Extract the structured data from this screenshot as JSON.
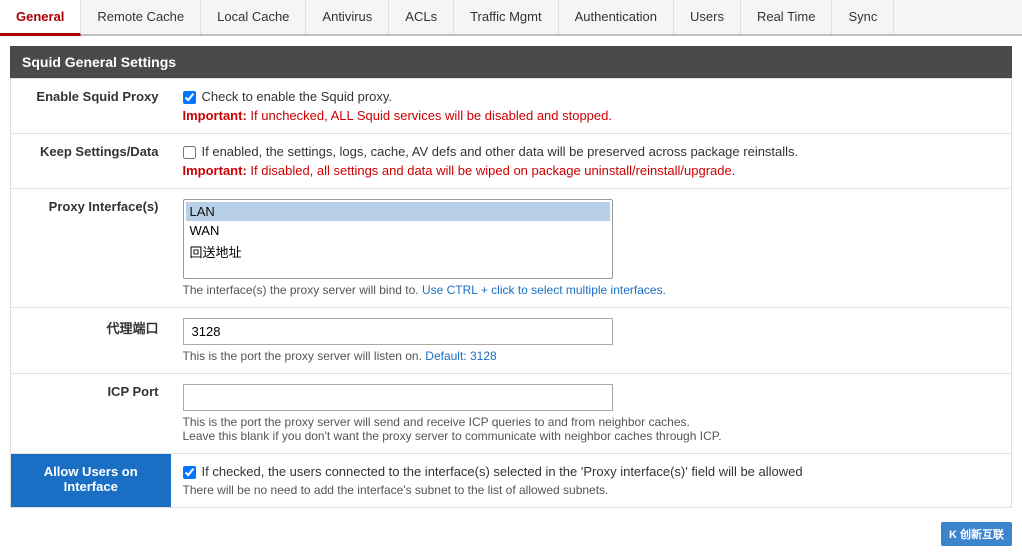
{
  "tabs": [
    {
      "id": "general",
      "label": "General",
      "active": true
    },
    {
      "id": "remote-cache",
      "label": "Remote Cache",
      "active": false
    },
    {
      "id": "local-cache",
      "label": "Local Cache",
      "active": false
    },
    {
      "id": "antivirus",
      "label": "Antivirus",
      "active": false
    },
    {
      "id": "acls",
      "label": "ACLs",
      "active": false
    },
    {
      "id": "traffic-mgmt",
      "label": "Traffic Mgmt",
      "active": false
    },
    {
      "id": "authentication",
      "label": "Authentication",
      "active": false
    },
    {
      "id": "users",
      "label": "Users",
      "active": false
    },
    {
      "id": "real-time",
      "label": "Real Time",
      "active": false
    },
    {
      "id": "sync",
      "label": "Sync",
      "active": false
    }
  ],
  "section_title": "Squid General Settings",
  "fields": {
    "enable_squid_proxy": {
      "label": "Enable Squid Proxy",
      "checkbox_text": "Check to enable the Squid proxy.",
      "important_label": "Important:",
      "important_text": " If unchecked, ALL Squid services will be disabled and stopped.",
      "checked": true
    },
    "keep_settings": {
      "label": "Keep Settings/Data",
      "checkbox_text": "If enabled, the settings, logs, cache, AV defs and other data will be preserved across package reinstalls.",
      "important_label": "Important:",
      "important_text": " If disabled, all settings and data will be wiped on package uninstall/reinstall/upgrade.",
      "checked": false
    },
    "proxy_interfaces": {
      "label": "Proxy Interface(s)",
      "options": [
        "LAN",
        "WAN",
        "回送地址"
      ],
      "selected": "LAN",
      "hint": "The interface(s) the proxy server will bind to.",
      "hint_link": "Use CTRL + click to select multiple interfaces.",
      "hint_after": ""
    },
    "proxy_port": {
      "label": "代理端口",
      "value": "3128",
      "placeholder": "",
      "hint": "This is the port the proxy server will listen on.",
      "default_label": "Default: 3128"
    },
    "icp_port": {
      "label": "ICP Port",
      "value": "",
      "placeholder": "",
      "hint1": "This is the port the proxy server will send and receive ICP queries to and from neighbor caches.",
      "hint2": "Leave this blank if you don't want the proxy server to communicate with neighbor caches through ICP."
    },
    "allow_users": {
      "label": "Allow Users on Interface",
      "highlight": true,
      "checkbox_text": "If checked, the users connected to the interface(s) selected in the 'Proxy interface(s)' field will be allowed",
      "hint": "There will be no need to add the interface's subnet to the list of allowed subnets.",
      "checked": true
    }
  },
  "watermark": {
    "line1": "CHUANG XIN HU LIAN",
    "logo": "K"
  }
}
